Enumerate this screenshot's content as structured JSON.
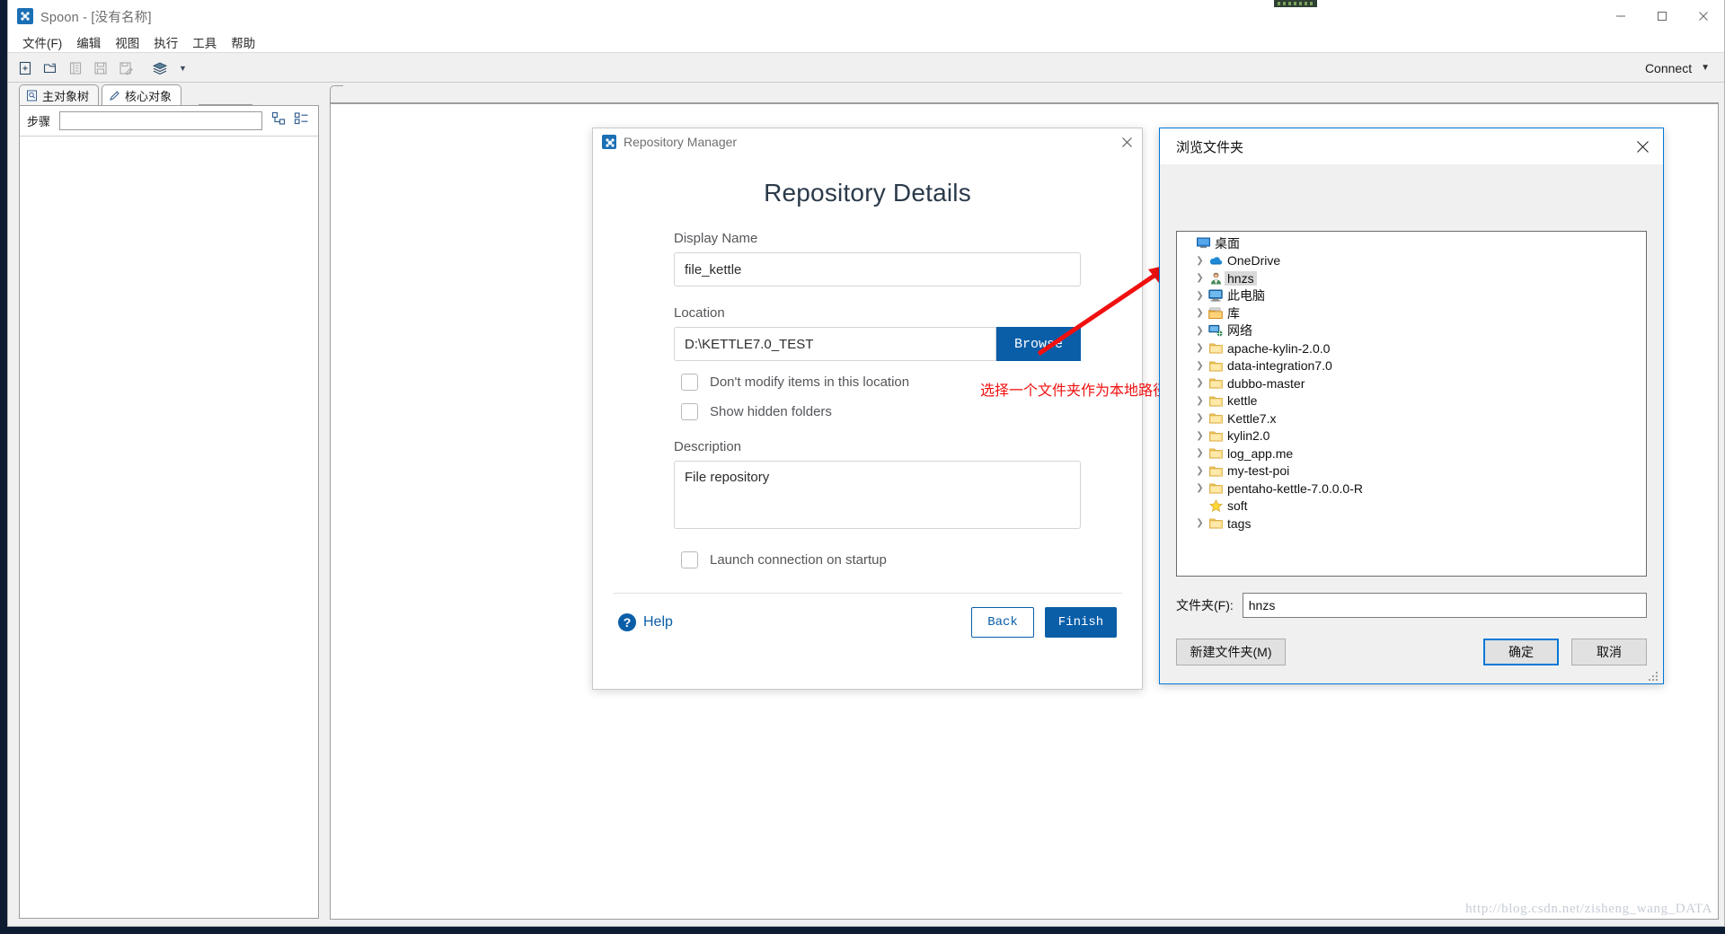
{
  "window": {
    "title": "Spoon - [没有名称]",
    "app_icon": "spoon-icon",
    "minimize": "−",
    "maximize": "□",
    "close": "✕"
  },
  "menubar": {
    "items": [
      {
        "label": "文件(F)"
      },
      {
        "label": "编辑"
      },
      {
        "label": "视图"
      },
      {
        "label": "执行"
      },
      {
        "label": "工具"
      },
      {
        "label": "帮助"
      }
    ]
  },
  "toolbar": {
    "buttons": [
      {
        "name": "new-file-icon",
        "enabled": true
      },
      {
        "name": "open-file-icon",
        "enabled": true
      },
      {
        "name": "explorer-icon",
        "enabled": false
      },
      {
        "name": "save-icon",
        "enabled": false
      },
      {
        "name": "save-as-icon",
        "enabled": false
      },
      {
        "name": "layers-icon",
        "enabled": true
      }
    ],
    "dropdown_caret": "▼",
    "connect_label": "Connect",
    "connect_caret": "▼"
  },
  "left_panel": {
    "tabs": [
      {
        "label": "主对象树",
        "icon": "document-icon",
        "active": false
      },
      {
        "label": "核心对象",
        "icon": "pencil-icon",
        "active": true
      }
    ],
    "search_label": "步骤",
    "search_value": "",
    "search_placeholder": "",
    "icons": [
      "expand-tree-icon",
      "collapse-tree-icon"
    ]
  },
  "canvas": {
    "watermark": "http://blog.csdn.net/zisheng_wang_DATA"
  },
  "repository_dialog": {
    "title": "Repository Manager",
    "close": "✕",
    "heading": "Repository Details",
    "fields": {
      "display_name_label": "Display Name",
      "display_name_value": "file_kettle",
      "location_label": "Location",
      "location_value": "D:\\KETTLE7.0_TEST",
      "browse_label": "Browse",
      "description_label": "Description",
      "description_value": "File repository"
    },
    "checkboxes": [
      {
        "label": "Don't modify items in this location",
        "checked": false
      },
      {
        "label": "Show hidden folders",
        "checked": false
      },
      {
        "label": "Launch connection on startup",
        "checked": false
      }
    ],
    "footer": {
      "help_label": "Help",
      "help_icon": "question-icon",
      "back_label": "Back",
      "finish_label": "Finish"
    }
  },
  "annotation": {
    "text": "选择一个文件夹作为本地路径",
    "color": "#f01010",
    "arrow": "red-arrow-icon"
  },
  "folder_dialog": {
    "title": "浏览文件夹",
    "close": "✕",
    "tree": [
      {
        "label": "桌面",
        "icon": "desktop-icon",
        "indent": 0,
        "arrow": false,
        "selected": false
      },
      {
        "label": "OneDrive",
        "icon": "onedrive-icon",
        "indent": 1,
        "arrow": true,
        "selected": false
      },
      {
        "label": "hnzs",
        "icon": "user-icon",
        "indent": 1,
        "arrow": true,
        "selected": true
      },
      {
        "label": "此电脑",
        "icon": "computer-icon",
        "indent": 1,
        "arrow": true,
        "selected": false
      },
      {
        "label": "库",
        "icon": "library-icon",
        "indent": 1,
        "arrow": true,
        "selected": false
      },
      {
        "label": "网络",
        "icon": "network-icon",
        "indent": 1,
        "arrow": true,
        "selected": false
      },
      {
        "label": "apache-kylin-2.0.0",
        "icon": "folder-icon",
        "indent": 1,
        "arrow": true,
        "selected": false
      },
      {
        "label": "data-integration7.0",
        "icon": "folder-icon",
        "indent": 1,
        "arrow": true,
        "selected": false
      },
      {
        "label": "dubbo-master",
        "icon": "folder-icon",
        "indent": 1,
        "arrow": true,
        "selected": false
      },
      {
        "label": "kettle",
        "icon": "folder-icon",
        "indent": 1,
        "arrow": true,
        "selected": false
      },
      {
        "label": "Kettle7.x",
        "icon": "folder-icon",
        "indent": 1,
        "arrow": true,
        "selected": false
      },
      {
        "label": "kylin2.0",
        "icon": "folder-icon",
        "indent": 1,
        "arrow": true,
        "selected": false
      },
      {
        "label": "log_app.me",
        "icon": "folder-icon",
        "indent": 1,
        "arrow": true,
        "selected": false
      },
      {
        "label": "my-test-poi",
        "icon": "folder-icon",
        "indent": 1,
        "arrow": true,
        "selected": false
      },
      {
        "label": "pentaho-kettle-7.0.0.0-R",
        "icon": "folder-icon",
        "indent": 1,
        "arrow": true,
        "selected": false
      },
      {
        "label": "soft",
        "icon": "star-icon",
        "indent": 1,
        "arrow": false,
        "selected": false
      },
      {
        "label": "tags",
        "icon": "folder-icon",
        "indent": 1,
        "arrow": true,
        "selected": false
      }
    ],
    "folder_label": "文件夹(F):",
    "folder_value": "hnzs",
    "new_folder_label": "新建文件夹(M)",
    "ok_label": "确定",
    "cancel_label": "取消"
  }
}
